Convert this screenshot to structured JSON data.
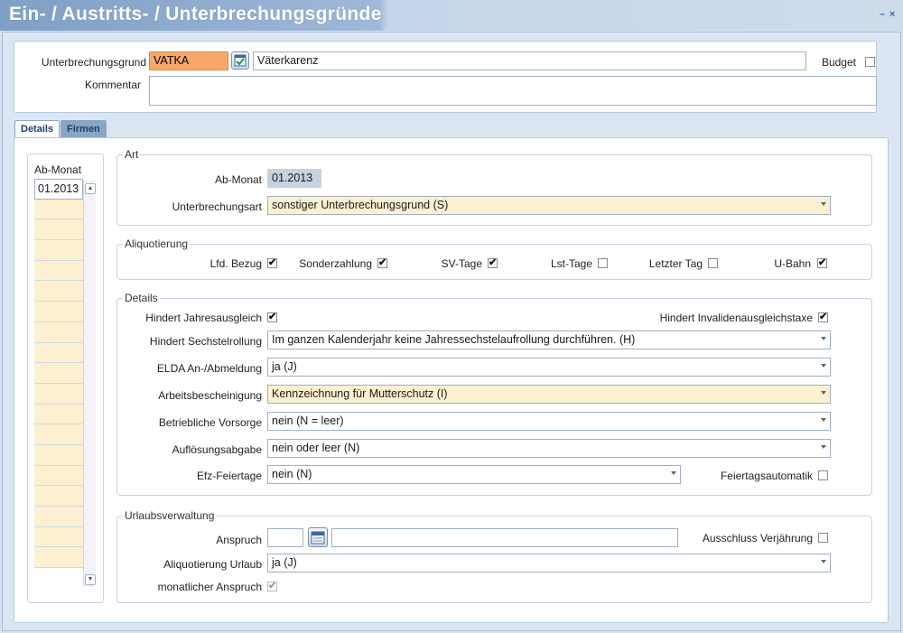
{
  "window": {
    "title": "Ein- / Austritts- / Unterbrechungsgründe",
    "minimize": "–",
    "close": "×"
  },
  "header": {
    "grund_label": "Unterbrechungsgrund",
    "grund_code": "VATKA",
    "grund_text": "Väterkarenz",
    "budget_label": "Budget",
    "budget_checked": false,
    "kommentar_label": "Kommentar",
    "kommentar_value": ""
  },
  "tabs": [
    {
      "label": "Details",
      "active": true
    },
    {
      "label": "Firmen",
      "active": false
    }
  ],
  "months": {
    "header": "Ab-Monat",
    "items": [
      "01.2013"
    ]
  },
  "art": {
    "title": "Art",
    "ab_monat_label": "Ab-Monat",
    "ab_monat_value": "01.2013",
    "unterbrechungsart_label": "Unterbrechungsart",
    "unterbrechungsart_value": "sonstiger Unterbrechungsgrund (S)"
  },
  "aliquotierung": {
    "title": "Aliquotierung",
    "items": [
      {
        "label": "Lfd. Bezug",
        "checked": true
      },
      {
        "label": "Sonderzahlung",
        "checked": true
      },
      {
        "label": "SV-Tage",
        "checked": true
      },
      {
        "label": "Lst-Tage",
        "checked": false
      },
      {
        "label": "Letzter Tag",
        "checked": false
      },
      {
        "label": "U-Bahn",
        "checked": true
      }
    ]
  },
  "details": {
    "title": "Details",
    "jahresausgleich_label": "Hindert Jahresausgleich",
    "jahresausgleich_checked": true,
    "invalid_label": "Hindert Invalidenausgleichstaxe",
    "invalid_checked": true,
    "sechstel_label": "Hindert Sechstelrollung",
    "sechstel_value": "Im ganzen Kalenderjahr keine Jahressechstelaufrollung durchführen. (H)",
    "elda_label": "ELDA An-/Abmeldung",
    "elda_value": "ja (J)",
    "arbeits_label": "Arbeitsbescheinigung",
    "arbeits_value": "Kennzeichnung für Mutterschutz (I)",
    "vorsorge_label": "Betriebliche Vorsorge",
    "vorsorge_value": "nein (N = leer)",
    "aufloesung_label": "Auflösungsabgabe",
    "aufloesung_value": "nein oder leer (N)",
    "efz_label": "Efz-Feiertage",
    "efz_value": "nein (N)",
    "feiertag_label": "Feiertagsautomatik",
    "feiertag_checked": false
  },
  "urlaub": {
    "title": "Urlaubsverwaltung",
    "anspruch_label": "Anspruch",
    "anspruch_value": "",
    "anspruch_text": "",
    "verjaehrung_label": "Ausschluss Verjährung",
    "verjaehrung_checked": false,
    "aliq_label": "Aliquotierung Urlaub",
    "aliq_value": "ja (J)",
    "monatlich_label": "monatlicher Anspruch",
    "monatlich_checked": true
  }
}
